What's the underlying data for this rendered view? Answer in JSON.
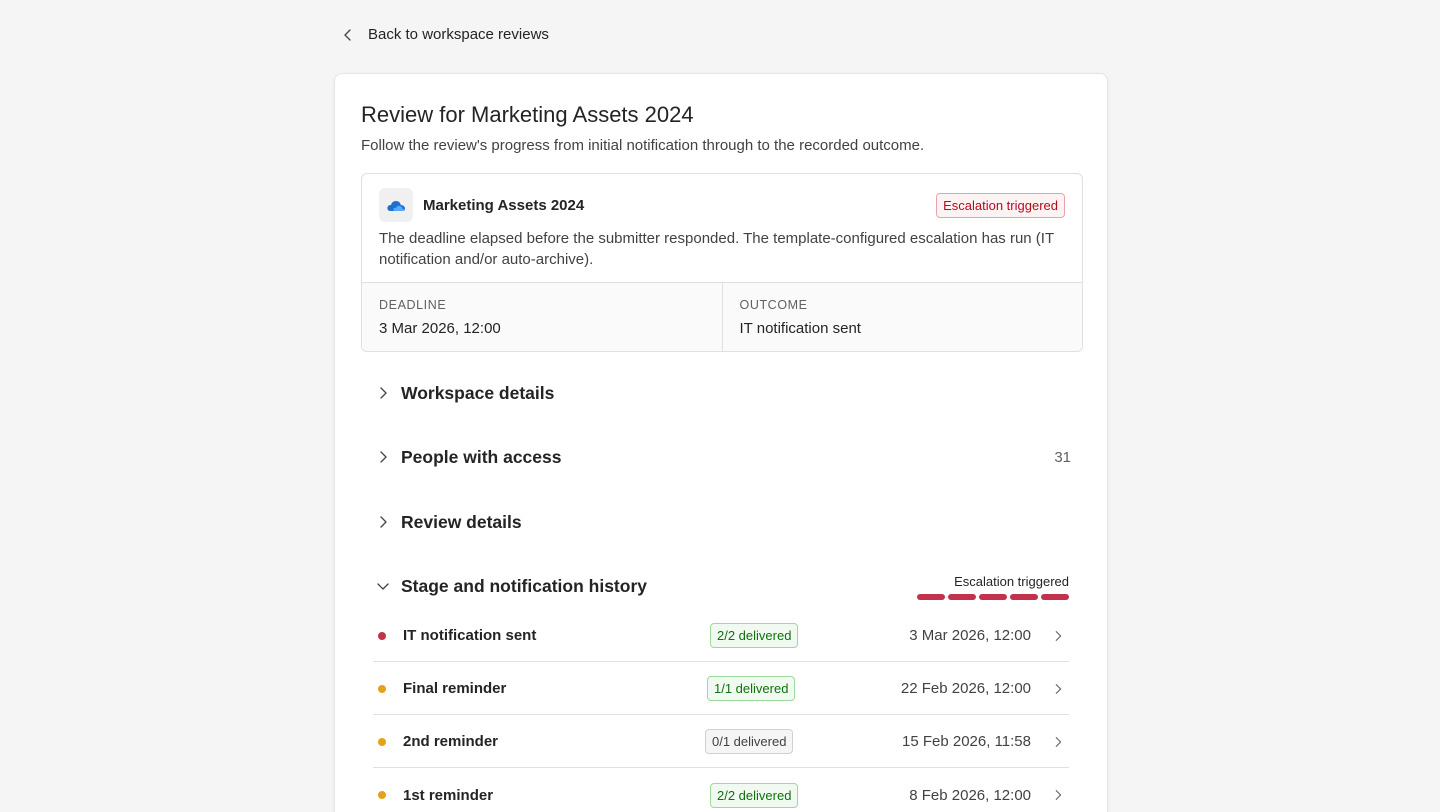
{
  "nav": {
    "back_label": "Back to workspace reviews"
  },
  "page": {
    "title": "Review for Marketing Assets 2024",
    "subtitle": "Follow the review's progress from initial notification through to the recorded outcome."
  },
  "summary": {
    "workspace_name": "Marketing Assets 2024",
    "workspace_icon": "cloud-icon",
    "status_badge": "Escalation triggered",
    "description": "The deadline elapsed before the submitter responded. The template-configured escalation has run (IT notification and/or auto-archive).",
    "deadline_label": "DEADLINE",
    "deadline_value": "3 Mar 2026, 12:00",
    "outcome_label": "OUTCOME",
    "outcome_value": "IT notification sent"
  },
  "sections": {
    "workspace_details": {
      "title": "Workspace details"
    },
    "people_with_access": {
      "title": "People with access",
      "count": "31"
    },
    "review_details": {
      "title": "Review details"
    },
    "stage_history": {
      "title": "Stage and notification history",
      "status_label": "Escalation triggered",
      "stages_completed": 5,
      "stages_total": 5
    }
  },
  "history": [
    {
      "title": "IT notification sent",
      "delivery": "2/2 delivered",
      "delivery_state": "ok",
      "date": "3 Mar 2026, 12:00",
      "dot_color": "#c4314b"
    },
    {
      "title": "Final reminder",
      "delivery": "1/1 delivered",
      "delivery_state": "ok",
      "date": "22 Feb 2026, 12:00",
      "dot_color": "#e3a21a"
    },
    {
      "title": "2nd reminder",
      "delivery": "0/1 delivered",
      "delivery_state": "none",
      "date": "15 Feb 2026, 11:58",
      "dot_color": "#e3a21a"
    },
    {
      "title": "1st reminder",
      "delivery": "2/2 delivered",
      "delivery_state": "ok",
      "date": "8 Feb 2026, 12:00",
      "dot_color": "#e3a21a"
    }
  ],
  "colors": {
    "escalation_red": "#c4314b",
    "reminder_amber": "#e3a21a",
    "delivered_green": "#0e700e"
  }
}
